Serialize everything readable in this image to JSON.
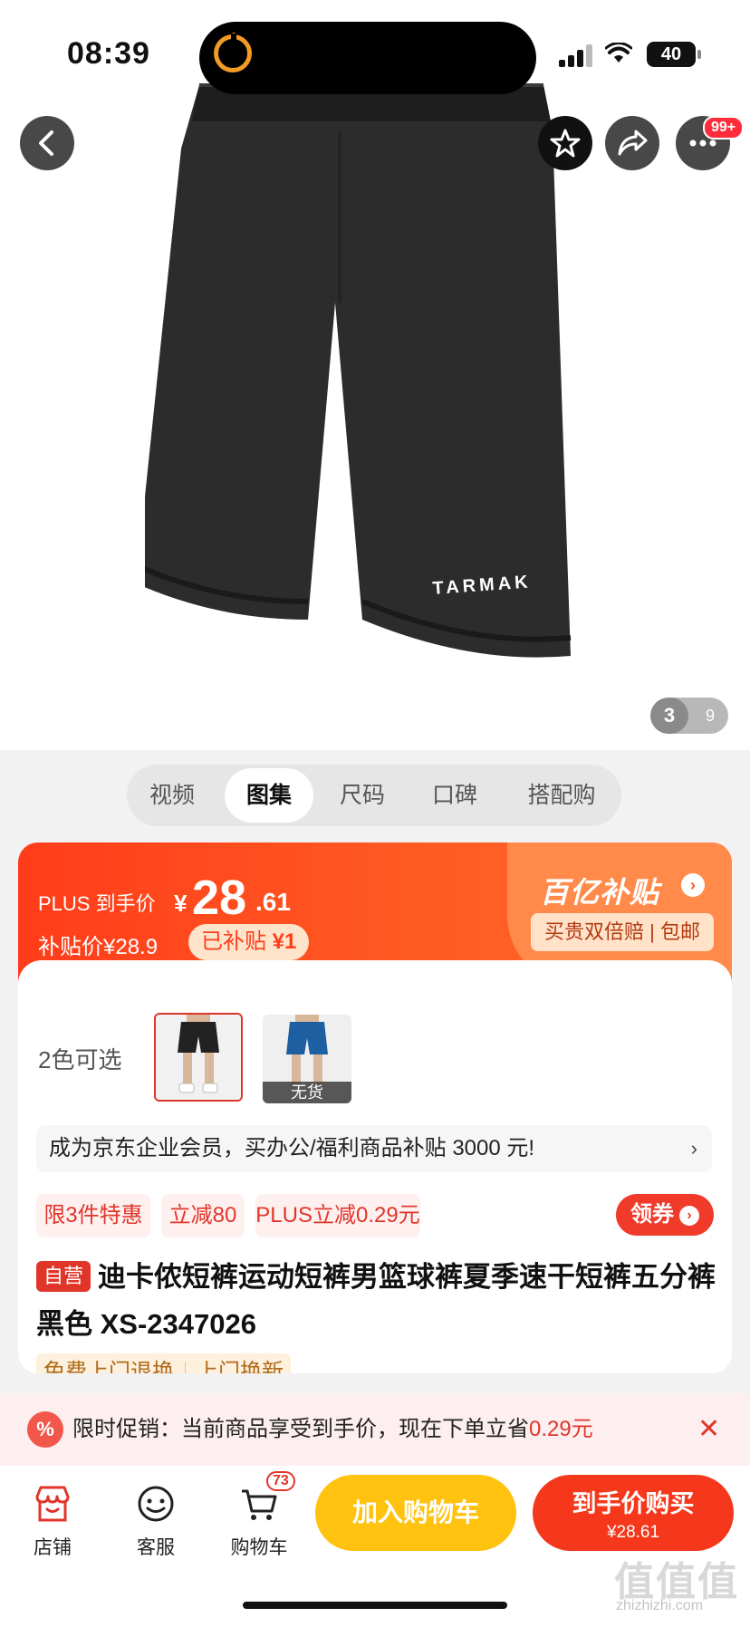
{
  "status_bar": {
    "time": "08:39",
    "battery": "40"
  },
  "hero": {
    "brand_print": "TARMAK",
    "more_badge": "99+",
    "pager_current": "3",
    "pager_total": "9"
  },
  "tabs": [
    {
      "label": "视频"
    },
    {
      "label": "图集"
    },
    {
      "label": "尺码"
    },
    {
      "label": "口碑"
    },
    {
      "label": "搭配购"
    }
  ],
  "active_tab": "图集",
  "price": {
    "plus_label": "PLUS 到手价",
    "currency": "¥",
    "price_int": "28",
    "price_dec": ".61",
    "subsidy_label": "补贴价¥28.9",
    "subsidy_tag_prefix": "已补贴",
    "subsidy_tag_value": "¥1",
    "program_title": "百亿补贴",
    "program_tags": "买贵双倍赔 | 包邮"
  },
  "colors": {
    "label": "2色可选",
    "out_of_stock": "无货",
    "accent": "#e0362a",
    "cart_yellow": "#ffc20e"
  },
  "enterprise": {
    "text": "成为京东企业会员，买办公/福利商品补贴 3000 元!",
    "arrow": "›"
  },
  "promos": [
    "限3件特惠",
    "立减80",
    "PLUS立减0.29元"
  ],
  "coupon_label": "领券",
  "product": {
    "self_tag": "自营",
    "title": "迪卡侬短裤运动短裤男篮球裤夏季速干短裤五分裤黑色 XS-2347026"
  },
  "services": [
    "免费上门退换",
    "上门换新"
  ],
  "promo_bar": {
    "icon": "%",
    "text_prefix": "限时促销：当前商品享受到手价，现在下单立省",
    "text_amount": "0.29元",
    "close": "✕"
  },
  "bottom_nav": [
    {
      "label": "店铺",
      "icon": "store-icon"
    },
    {
      "label": "客服",
      "icon": "customer-service-icon"
    },
    {
      "label": "购物车",
      "icon": "cart-icon"
    }
  ],
  "cart_count": "73",
  "actions": {
    "add_cart": "加入购物车",
    "buy_line1": "到手价购买",
    "buy_line2": "¥28.61"
  },
  "watermark": {
    "main": "值值值",
    "sub": "zhizhizhi.com"
  }
}
